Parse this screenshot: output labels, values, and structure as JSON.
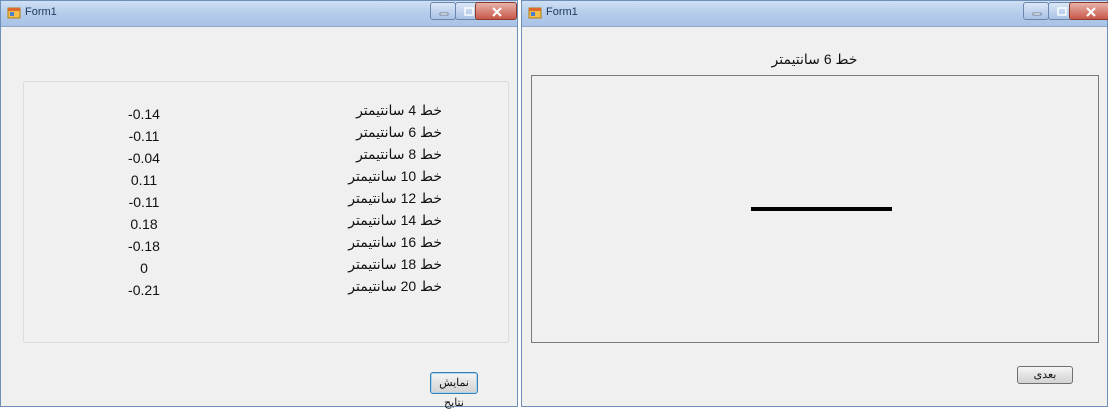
{
  "left_window": {
    "title": "Form1",
    "rows": [
      {
        "label": "خط 4 سانتیمتر",
        "value": "-0.14"
      },
      {
        "label": "خط 6 سانتیمتر",
        "value": "-0.11"
      },
      {
        "label": "خط 8 سانتیمتر",
        "value": "-0.04"
      },
      {
        "label": "خط 10 سانتیمتر",
        "value": "0.11"
      },
      {
        "label": "خط 12 سانتیمتر",
        "value": "-0.11"
      },
      {
        "label": "خط 14 سانتیمتر",
        "value": "0.18"
      },
      {
        "label": "خط 16 سانتیمتر",
        "value": "-0.18"
      },
      {
        "label": "خط 18 سانتیمتر",
        "value": "0"
      },
      {
        "label": "خط 20 سانتیمتر",
        "value": "-0.21"
      }
    ],
    "show_results_button": "نمایش نتایج"
  },
  "right_window": {
    "title": "Form1",
    "line_title": "خط 6 سانتیمتر",
    "next_button": "بعدی"
  },
  "colors": {
    "window_bg": "#f0f0f0",
    "titlebar": "#b6cdeb",
    "close_button": "#c8584a",
    "drawn_line": "#000000"
  },
  "icons": [
    "app-icon",
    "minimize-icon",
    "maximize-icon",
    "close-icon"
  ]
}
